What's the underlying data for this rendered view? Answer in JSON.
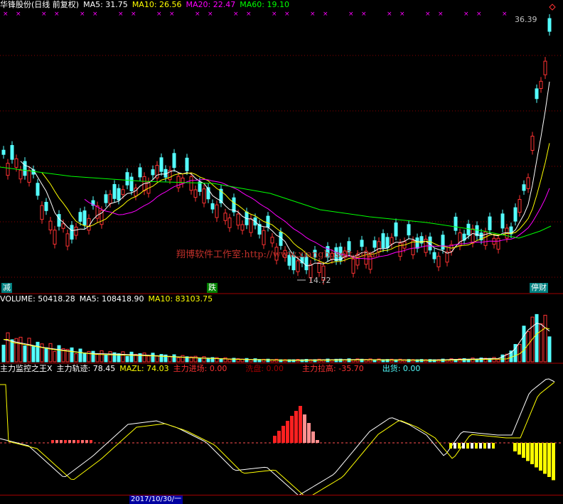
{
  "price_panel": {
    "title": "华锋股份(日线 前复权)",
    "ma5": "MA5: 31.75",
    "ma10": "MA10: 26.56",
    "ma20": "MA20: 22.47",
    "ma60": "MA60: 19.10",
    "high_label": "36.39",
    "low_label": "14.72",
    "watermark": "翔博软件工作室:http://www.xiangbosoft.com/",
    "signal_left": "减",
    "signal_mid": "跌",
    "signal_right": "停财",
    "colors": {
      "ma5": "#ffffff",
      "ma10": "#ffff00",
      "ma20": "#ff00ff",
      "ma60": "#00ff00",
      "up": "#ff3232",
      "down": "#54ffff"
    }
  },
  "volume_panel": {
    "volume": "VOLUME: 50418.28",
    "ma5": "MA5: 108418.90",
    "ma10": "MA10: 83103.75"
  },
  "indicator_panel": {
    "name": "主力监控之王X",
    "track": "主力轨迹: 78.45",
    "mazl": "MAZL: 74.03",
    "enter": "主力进场: 0.00",
    "wash": "洗盘: 0.00",
    "raise": "主力拉高: -35.70",
    "ship": "出货: 0.00"
  },
  "bottom_axis": {
    "date_label": "2017/10/30/一"
  }
}
